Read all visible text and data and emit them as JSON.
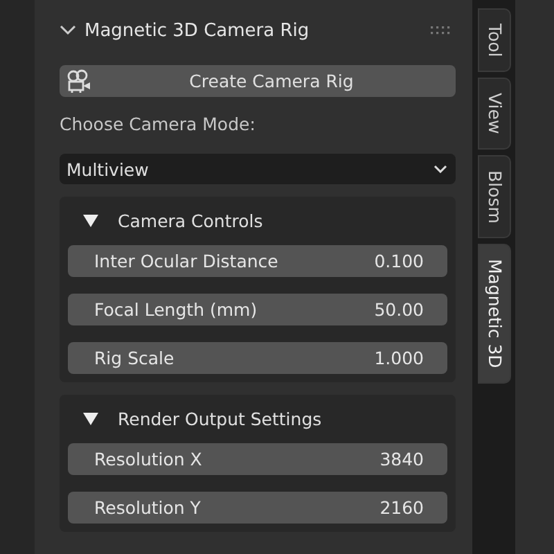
{
  "panel": {
    "title": "Magnetic 3D Camera Rig",
    "expanded": true,
    "create_button": {
      "label": "Create Camera Rig"
    },
    "mode_label": "Choose Camera Mode:",
    "mode_dropdown": {
      "value": "Multiview"
    },
    "subpanels": [
      {
        "title": "Camera Controls",
        "expanded": true,
        "fields": [
          {
            "label": "Inter Ocular Distance",
            "value": "0.100"
          },
          {
            "label": "Focal Length (mm)",
            "value": "50.00"
          },
          {
            "label": "Rig Scale",
            "value": "1.000"
          }
        ]
      },
      {
        "title": "Render Output Settings",
        "expanded": true,
        "fields": [
          {
            "label": "Resolution X",
            "value": "3840"
          },
          {
            "label": "Resolution Y",
            "value": "2160"
          }
        ]
      }
    ]
  },
  "tabs": [
    {
      "label": "Tool",
      "selected": false
    },
    {
      "label": "View",
      "selected": false
    },
    {
      "label": "Blosm",
      "selected": false
    },
    {
      "label": "Magnetic 3D",
      "selected": true
    }
  ]
}
